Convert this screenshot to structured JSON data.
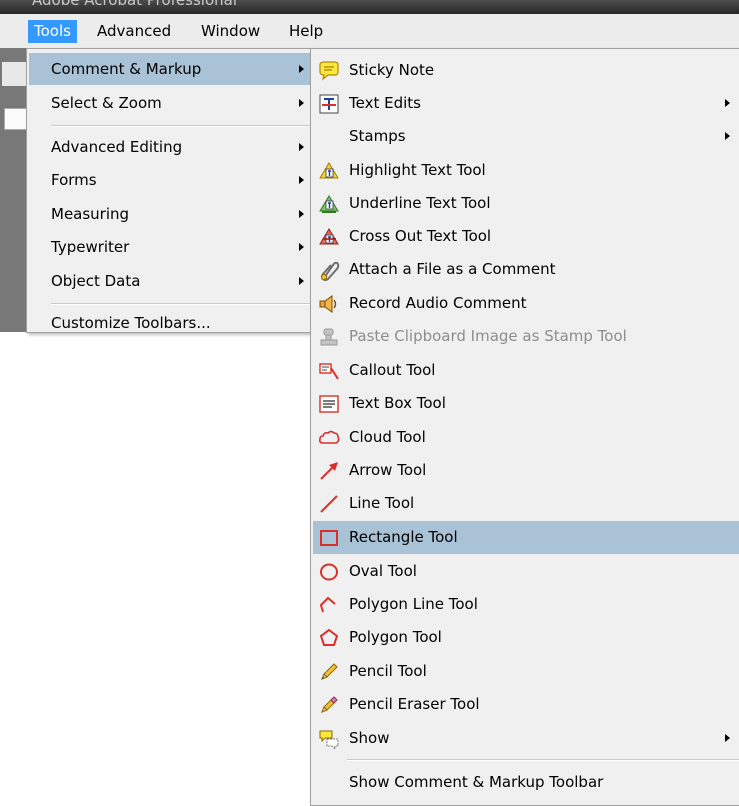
{
  "title_bar": {
    "text": "Adobe Acrobat Professional"
  },
  "menubar": {
    "items": [
      {
        "label": "Tools"
      },
      {
        "label": "Advanced"
      },
      {
        "label": "Window"
      },
      {
        "label": "Help"
      }
    ]
  },
  "tools_menu": {
    "items": [
      {
        "label": "Comment & Markup",
        "submenu": true,
        "highlighted": true
      },
      {
        "label": "Select & Zoom",
        "submenu": true
      },
      {
        "label": "Advanced Editing",
        "submenu": true
      },
      {
        "label": "Forms",
        "submenu": true
      },
      {
        "label": "Measuring",
        "submenu": true
      },
      {
        "label": "Typewriter",
        "submenu": true
      },
      {
        "label": "Object Data",
        "submenu": true
      },
      {
        "label": "Customize Toolbars...",
        "submenu": false
      }
    ]
  },
  "comment_markup_menu": {
    "items": [
      {
        "label": "Sticky Note",
        "icon": "sticky-note-icon"
      },
      {
        "label": "Text Edits",
        "icon": "text-edits-icon",
        "submenu": true
      },
      {
        "label": "Stamps",
        "icon": "",
        "submenu": true
      },
      {
        "label": "Highlight Text Tool",
        "icon": "highlight-text-icon"
      },
      {
        "label": "Underline Text Tool",
        "icon": "underline-text-icon"
      },
      {
        "label": "Cross Out Text Tool",
        "icon": "cross-out-text-icon"
      },
      {
        "label": "Attach a File as a Comment",
        "icon": "paperclip-icon"
      },
      {
        "label": "Record Audio Comment",
        "icon": "speaker-icon"
      },
      {
        "label": "Paste Clipboard Image as Stamp Tool",
        "icon": "clipboard-stamp-icon",
        "disabled": true
      },
      {
        "label": "Callout Tool",
        "icon": "callout-icon"
      },
      {
        "label": "Text Box Tool",
        "icon": "text-box-icon"
      },
      {
        "label": "Cloud Tool",
        "icon": "cloud-icon"
      },
      {
        "label": "Arrow Tool",
        "icon": "arrow-icon"
      },
      {
        "label": "Line Tool",
        "icon": "line-icon"
      },
      {
        "label": "Rectangle Tool",
        "icon": "rectangle-icon",
        "highlighted": true
      },
      {
        "label": "Oval Tool",
        "icon": "oval-icon"
      },
      {
        "label": "Polygon Line Tool",
        "icon": "polygon-line-icon"
      },
      {
        "label": "Polygon Tool",
        "icon": "polygon-icon"
      },
      {
        "label": "Pencil Tool",
        "icon": "pencil-icon"
      },
      {
        "label": "Pencil Eraser Tool",
        "icon": "pencil-eraser-icon"
      },
      {
        "label": "Show",
        "icon": "show-comments-icon",
        "submenu": true
      },
      {
        "label": "Show Comment & Markup Toolbar",
        "icon": ""
      }
    ]
  },
  "colors": {
    "menu_highlight": "#a9c2d6",
    "menubar_active": "#3399ff",
    "markup_red": "#d9302c"
  }
}
